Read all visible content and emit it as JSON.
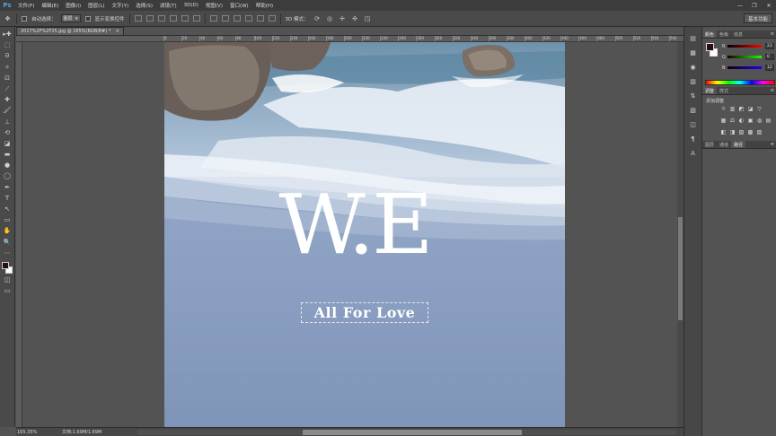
{
  "app": {
    "logo": "Ps"
  },
  "menu": [
    "文件(F)",
    "编辑(E)",
    "图像(I)",
    "图层(L)",
    "文字(Y)",
    "选择(S)",
    "滤镜(T)",
    "3D(D)",
    "视图(V)",
    "窗口(W)",
    "帮助(H)"
  ],
  "window_controls": {
    "minimize": "—",
    "restore": "❐",
    "close": "✕"
  },
  "options": {
    "auto_select_label": "自动选择：",
    "auto_select_value": "图层",
    "show_transform_label": "显示变换控件",
    "mode_3d_label": "3D 模式：",
    "workspace": "基本功能"
  },
  "document": {
    "tab_title": "2017%2F%2F25.jpg @ 165%(RGB/8#) *",
    "close": "×"
  },
  "ruler_ticks": [
    "0",
    "20",
    "40",
    "60",
    "80",
    "100",
    "120",
    "140",
    "160",
    "180",
    "200",
    "220",
    "240",
    "260",
    "280",
    "300",
    "320",
    "340",
    "360",
    "380",
    "400",
    "420",
    "440",
    "460",
    "480",
    "500",
    "520",
    "540",
    "560",
    "580",
    "600",
    "620",
    "640",
    "660",
    "680",
    "700",
    "720"
  ],
  "canvas": {
    "logo_text": "W.E",
    "tagline": "All For Love"
  },
  "status": {
    "zoom": "165.35%",
    "doc_info": "文档:1.69M/1.69M"
  },
  "color_panel": {
    "tabs": [
      "颜色",
      "色板",
      "信息"
    ],
    "active_tab": 0,
    "menu": "≡",
    "fg_color": "#2a0d0f",
    "sliders": [
      {
        "label": "R",
        "value": "23",
        "gradient": "linear-gradient(to right,#000000,#ff0000)"
      },
      {
        "label": "G",
        "value": "0",
        "gradient": "linear-gradient(to right,#170000,#17ff00)"
      },
      {
        "label": "B",
        "value": "12",
        "gradient": "linear-gradient(to right,#170000,#1700ff)"
      }
    ]
  },
  "adjust_panel": {
    "tabs": [
      "调整",
      "样式"
    ],
    "active_tab": 0,
    "title": "添加调整",
    "menu": "≡",
    "row1": [
      "☼",
      "▥",
      "◩",
      "◪",
      "▽"
    ],
    "row2": [
      "▦",
      "⚖",
      "◐",
      "▣",
      "◍",
      "▤"
    ],
    "row3": [
      "◧",
      "◨",
      "▨",
      "▩",
      "▧"
    ]
  },
  "layers_panel": {
    "tabs": [
      "图层",
      "通道",
      "路径"
    ],
    "active_tab": 2,
    "menu": "≡"
  },
  "tools": [
    "▸✚",
    "⬚",
    "ᘐ",
    "✧",
    "⊡",
    "⟋",
    "✚",
    "🖌",
    "⊥",
    "⟲",
    "◪",
    "▬",
    "●",
    "◯",
    "✒",
    "T",
    "↖",
    "▭",
    "✋",
    "🔍",
    "⋯"
  ],
  "strip_icons": [
    "▤",
    "▦",
    "◉",
    "▥",
    "⇅",
    "▧",
    "◫",
    "¶",
    "A"
  ]
}
